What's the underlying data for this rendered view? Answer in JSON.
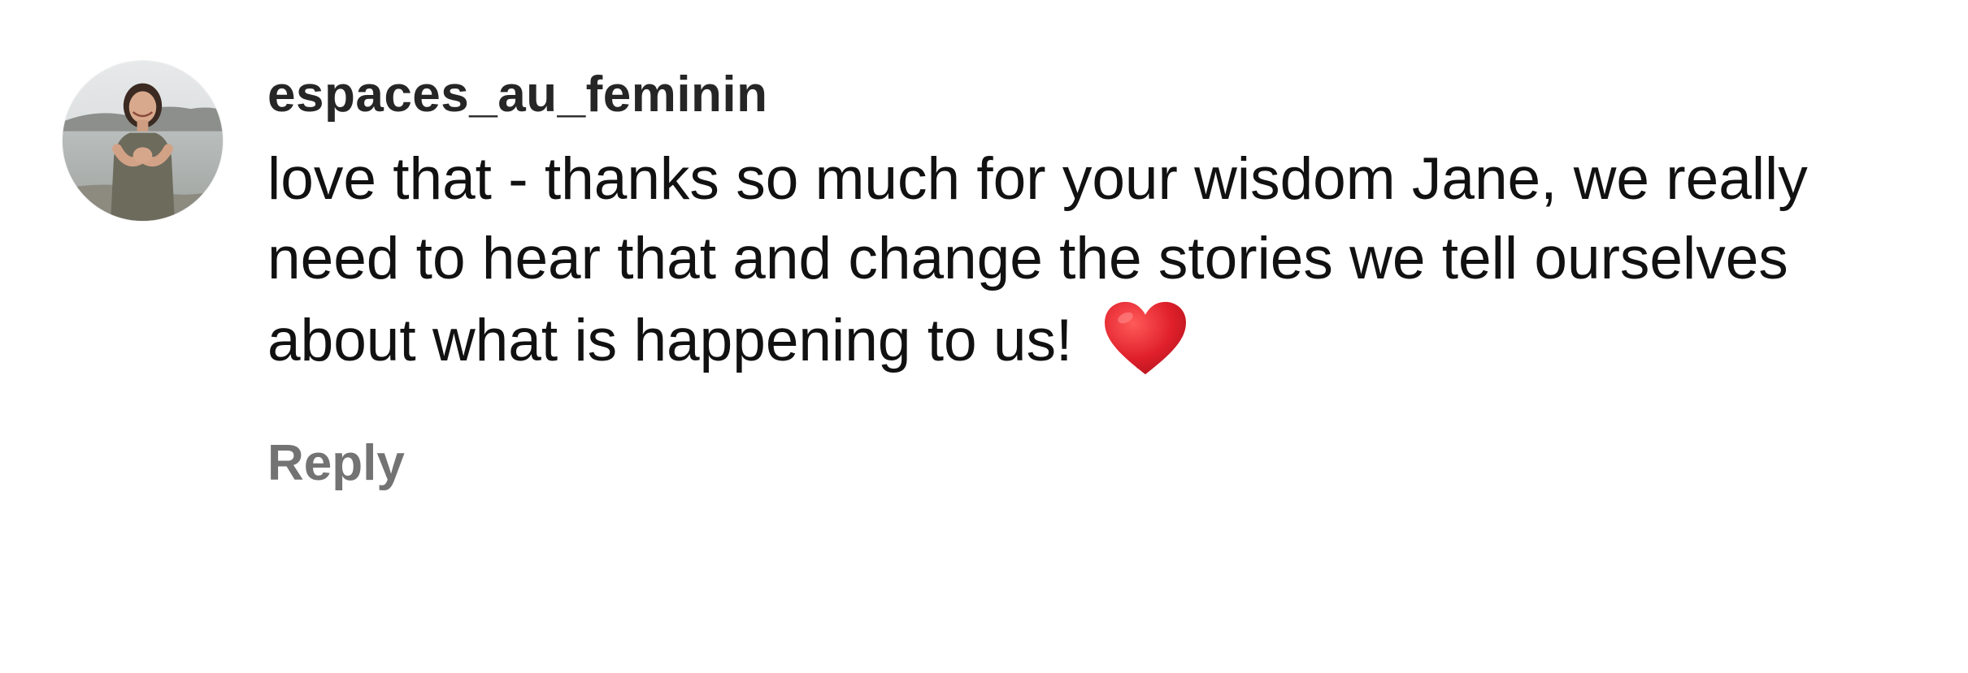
{
  "comment": {
    "username": "espaces_au_feminin",
    "text": "love that - thanks so much for your wisdom Jane, we really need to hear that and change the stories we tell ourselves about what is happening to us!",
    "emoji_icon": "red-heart-icon",
    "reply_label": "Reply"
  },
  "colors": {
    "username": "#262626",
    "text": "#111111",
    "reply": "#737373",
    "heart": "#e0202b"
  }
}
